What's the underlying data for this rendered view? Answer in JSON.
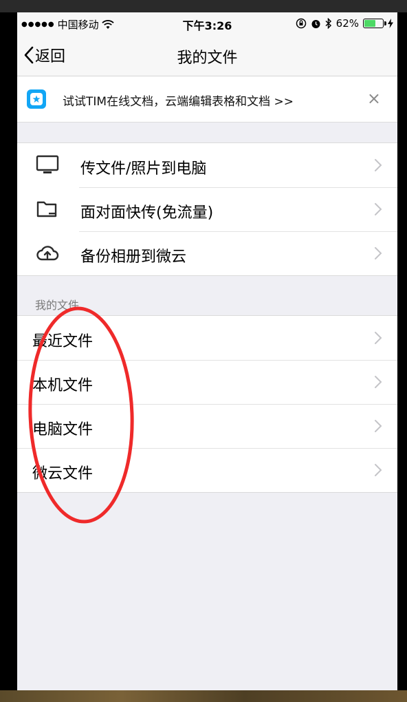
{
  "status_bar": {
    "carrier": "中国移动",
    "time": "下午3:26",
    "battery_percent_label": "62%",
    "battery_level": 0.62
  },
  "nav": {
    "back_label": "返回",
    "title": "我的文件"
  },
  "banner": {
    "text": "试试TIM在线文档，云端编辑表格和文档 >>",
    "close_glyph": "×",
    "logo_color": "#12a6f5"
  },
  "transfer_items": [
    {
      "label": "传文件/照片到电脑",
      "icon": "monitor-icon"
    },
    {
      "label": "面对面快传(免流量)",
      "icon": "folder-icon"
    },
    {
      "label": "备份相册到微云",
      "icon": "cloud-upload-icon"
    }
  ],
  "my_files": {
    "header": "我的文件",
    "items": [
      {
        "label": "最近文件"
      },
      {
        "label": "本机文件"
      },
      {
        "label": "电脑文件"
      },
      {
        "label": "微云文件"
      }
    ]
  },
  "colors": {
    "annotation": "#ef2a2a",
    "battery": "#4cd964",
    "icon": "#2b2b2b"
  }
}
